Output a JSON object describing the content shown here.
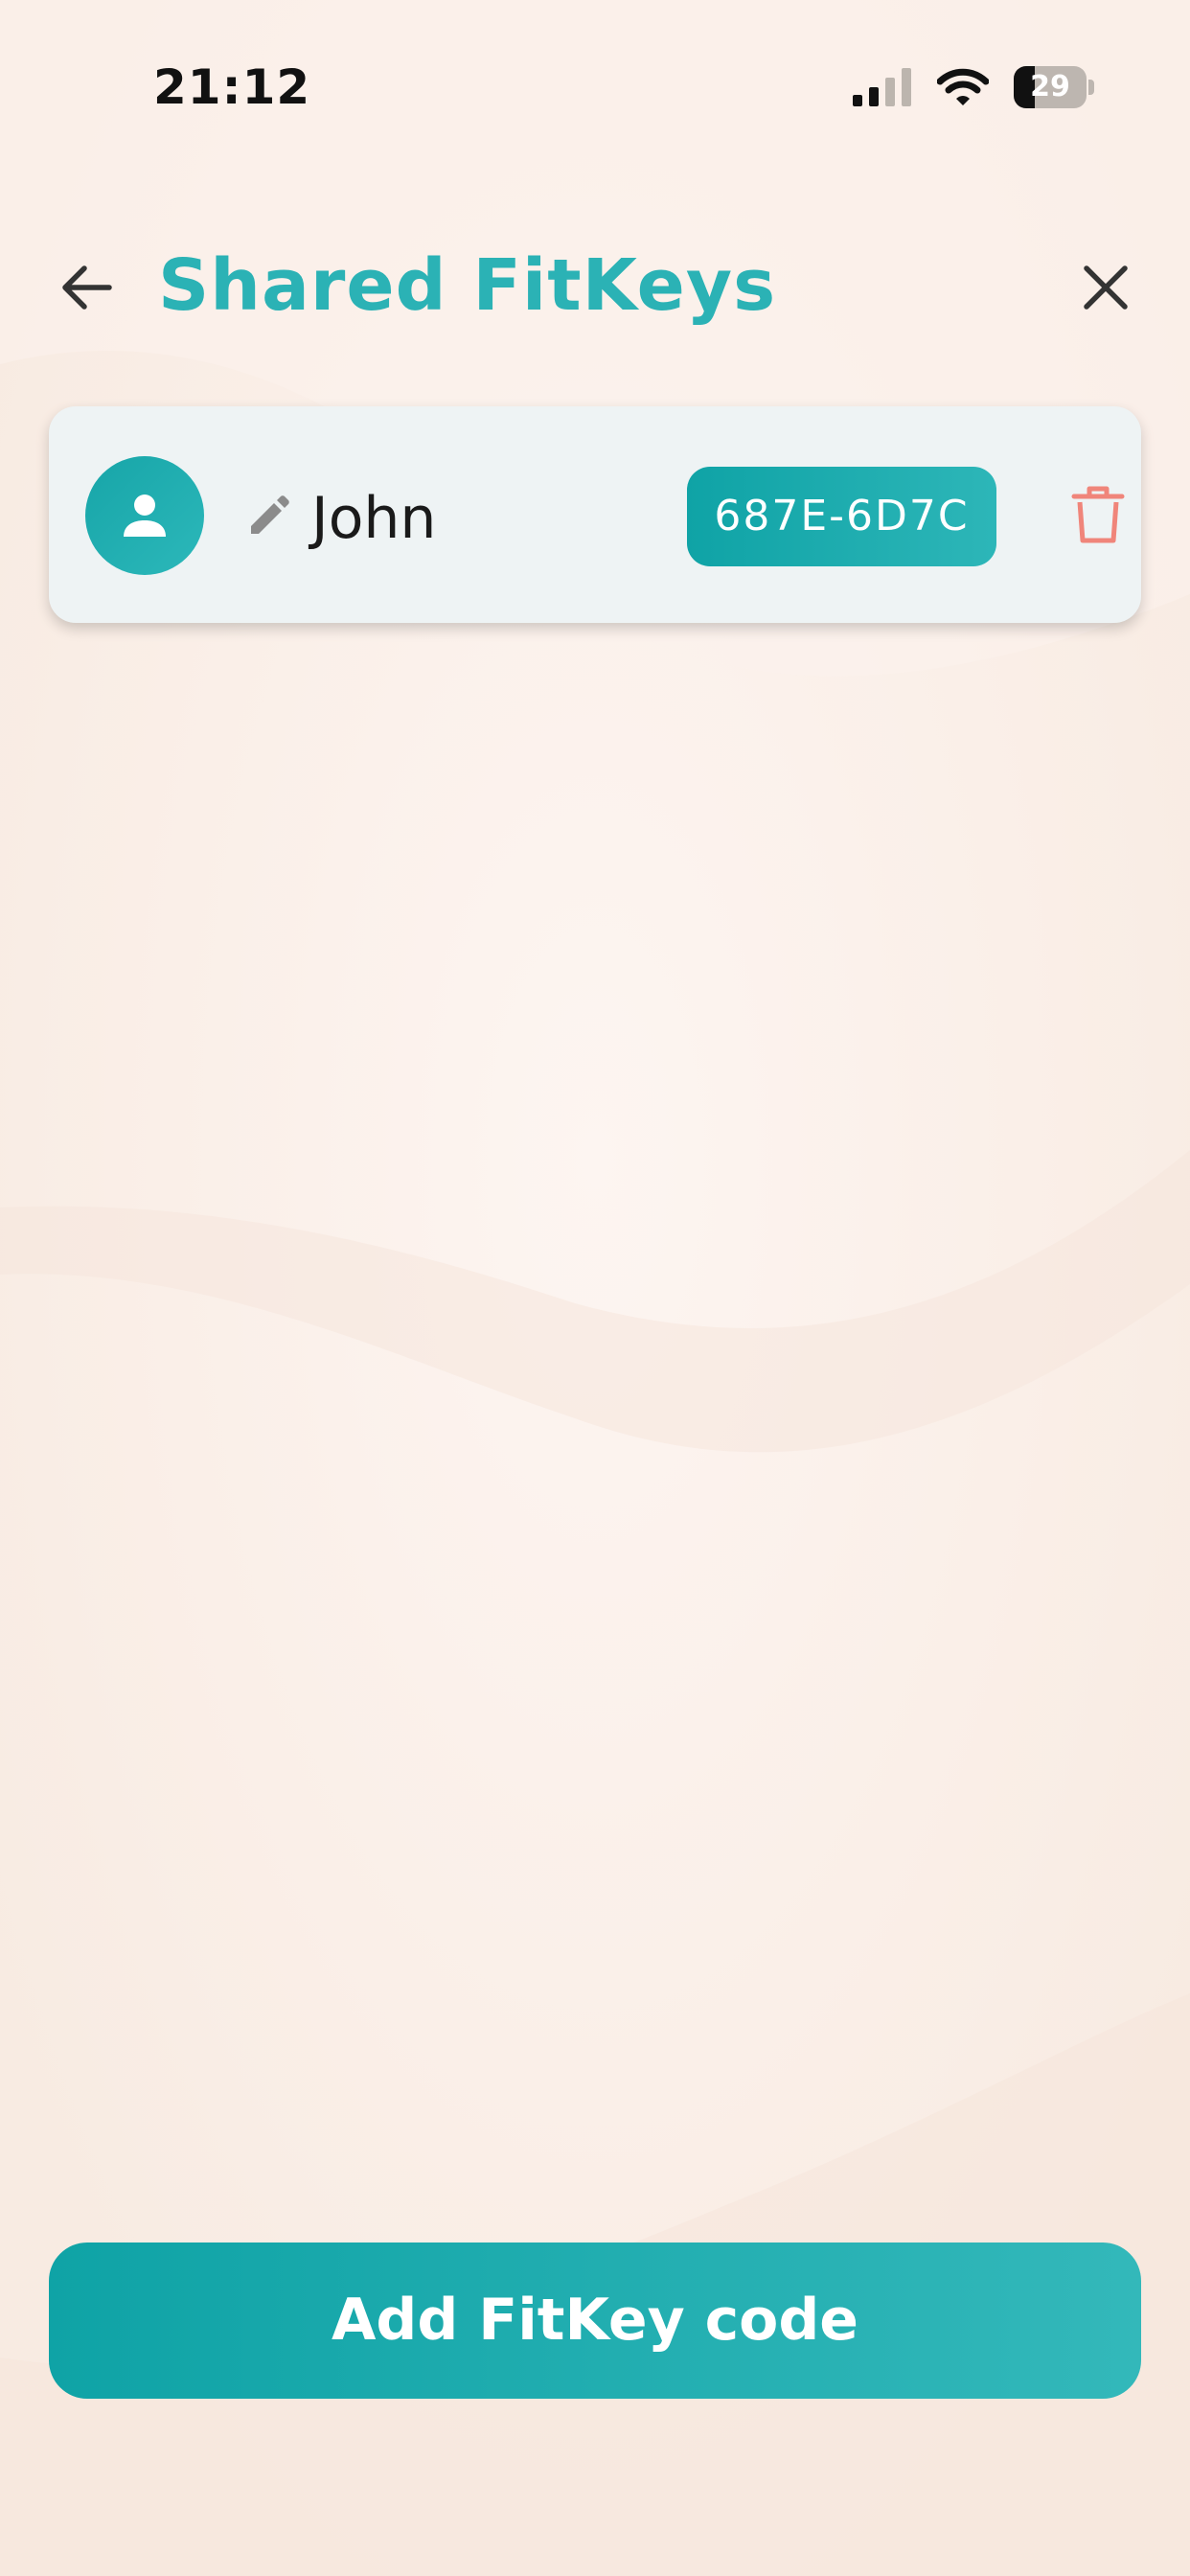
{
  "status_bar": {
    "time": "21:12",
    "battery_percent": 29,
    "battery_label": "29",
    "signal_icon": "cellular-signal-icon",
    "wifi_icon": "wifi-icon",
    "battery_icon": "battery-icon"
  },
  "header": {
    "title": "Shared FitKeys",
    "back_icon": "arrow-left-icon",
    "close_icon": "close-icon"
  },
  "shared_fitkeys": [
    {
      "name": "John",
      "code": "687E-6D7C",
      "avatar_icon": "person-icon",
      "edit_icon": "pencil-icon",
      "delete_icon": "trash-icon"
    }
  ],
  "actions": {
    "add_label": "Add FitKey code"
  },
  "colors": {
    "accent": "#2bb2b5",
    "accent_dark": "#0fa3a6",
    "delete": "#f0857a",
    "background": "#fbf1ea",
    "card": "#eef3f4"
  }
}
